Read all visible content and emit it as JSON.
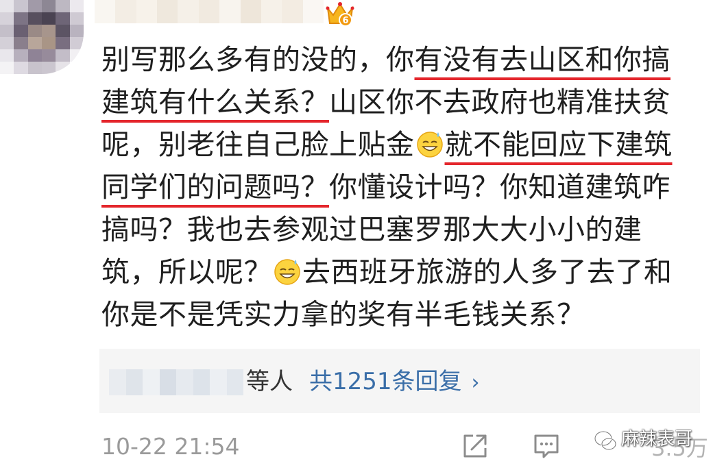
{
  "comment": {
    "lines": [
      [
        "别写那么多有的没的，你",
        "有没有去山区和你搞"
      ],
      [
        "建筑有什么关系？",
        "山区你不去政府也精准扶贫"
      ],
      [
        "呢，别老往自己脸上贴金",
        "就不能回应下建筑"
      ],
      [
        "同学们的问题吗？",
        "你懂设计吗？你知道建筑咋"
      ],
      [
        "搞吗？我也去参观过巴塞罗那大大小小的建"
      ],
      [
        "筑，所以呢？",
        "去西班牙旅游的人多了去了和"
      ],
      [
        "你是不是凭实力拿的奖有半毛钱关系？"
      ]
    ],
    "emoji_icon": "grin-sweat-emoji-icon"
  },
  "header": {
    "vip_badge_number": "6",
    "vip_badge_icon": "crown-icon"
  },
  "replies": {
    "suffix": "等人",
    "link": "共1251条回复",
    "chevron": "›"
  },
  "footer": {
    "timestamp": "10-22 21:54",
    "share_icon": "share-icon",
    "reply_icon": "comment-icon",
    "likes": "3.5万",
    "watermark": "麻辣表哥"
  },
  "colors": {
    "underline": "#e4262c",
    "link": "#3a6ea8",
    "reply_box_bg": "#f5f5f5",
    "timestamp": "#9a9a9a"
  }
}
